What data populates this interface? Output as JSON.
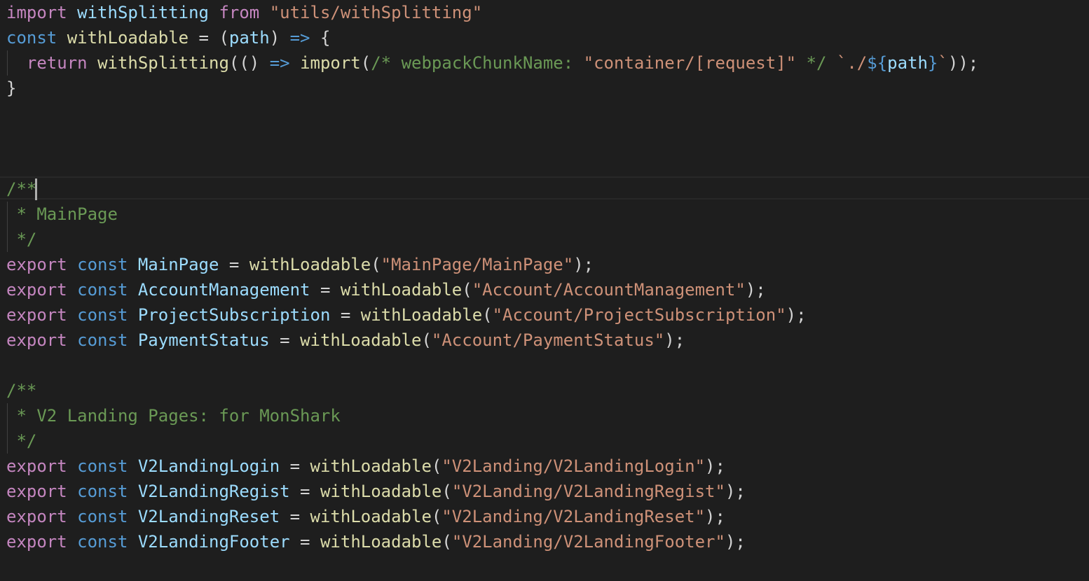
{
  "editor": {
    "lines": [
      {
        "tokens": [
          {
            "t": "import",
            "c": "kw"
          },
          {
            "t": " ",
            "c": "plain"
          },
          {
            "t": "withSplitting",
            "c": "var"
          },
          {
            "t": " ",
            "c": "plain"
          },
          {
            "t": "from",
            "c": "kw"
          },
          {
            "t": " ",
            "c": "plain"
          },
          {
            "t": "\"utils/withSplitting\"",
            "c": "str"
          }
        ]
      },
      {
        "tokens": [
          {
            "t": "const",
            "c": "storage"
          },
          {
            "t": " ",
            "c": "plain"
          },
          {
            "t": "withLoadable",
            "c": "fn"
          },
          {
            "t": " = (",
            "c": "plain"
          },
          {
            "t": "path",
            "c": "var"
          },
          {
            "t": ") ",
            "c": "plain"
          },
          {
            "t": "=>",
            "c": "storage"
          },
          {
            "t": " {",
            "c": "plain"
          }
        ]
      },
      {
        "tokens": [
          {
            "t": "  ",
            "c": "plain"
          },
          {
            "t": "return",
            "c": "kw"
          },
          {
            "t": " ",
            "c": "plain"
          },
          {
            "t": "withSplitting",
            "c": "fn"
          },
          {
            "t": "(() ",
            "c": "plain"
          },
          {
            "t": "=>",
            "c": "storage"
          },
          {
            "t": " ",
            "c": "plain"
          },
          {
            "t": "import",
            "c": "fn"
          },
          {
            "t": "(",
            "c": "plain"
          },
          {
            "t": "/* webpackChunkName: ",
            "c": "cmt"
          },
          {
            "t": "\"container/[request]\"",
            "c": "str"
          },
          {
            "t": " */",
            "c": "cmt"
          },
          {
            "t": " ",
            "c": "plain"
          },
          {
            "t": "`./",
            "c": "str"
          },
          {
            "t": "${",
            "c": "storage"
          },
          {
            "t": "path",
            "c": "var"
          },
          {
            "t": "}",
            "c": "storage"
          },
          {
            "t": "`",
            "c": "str"
          },
          {
            "t": "));",
            "c": "plain"
          }
        ]
      },
      {
        "tokens": [
          {
            "t": "}",
            "c": "plain"
          }
        ]
      },
      {
        "tokens": []
      },
      {
        "tokens": []
      },
      {
        "tokens": []
      },
      {
        "tokens": [
          {
            "t": "/**",
            "c": "cmt"
          }
        ]
      },
      {
        "tokens": [
          {
            "t": " * MainPage",
            "c": "cmt"
          }
        ]
      },
      {
        "tokens": [
          {
            "t": " */",
            "c": "cmt"
          }
        ]
      },
      {
        "tokens": [
          {
            "t": "export",
            "c": "kw"
          },
          {
            "t": " ",
            "c": "plain"
          },
          {
            "t": "const",
            "c": "storage"
          },
          {
            "t": " ",
            "c": "plain"
          },
          {
            "t": "MainPage",
            "c": "var"
          },
          {
            "t": " = ",
            "c": "plain"
          },
          {
            "t": "withLoadable",
            "c": "fn"
          },
          {
            "t": "(",
            "c": "plain"
          },
          {
            "t": "\"MainPage/MainPage\"",
            "c": "str"
          },
          {
            "t": ");",
            "c": "plain"
          }
        ]
      },
      {
        "tokens": [
          {
            "t": "export",
            "c": "kw"
          },
          {
            "t": " ",
            "c": "plain"
          },
          {
            "t": "const",
            "c": "storage"
          },
          {
            "t": " ",
            "c": "plain"
          },
          {
            "t": "AccountManagement",
            "c": "var"
          },
          {
            "t": " = ",
            "c": "plain"
          },
          {
            "t": "withLoadable",
            "c": "fn"
          },
          {
            "t": "(",
            "c": "plain"
          },
          {
            "t": "\"Account/AccountManagement\"",
            "c": "str"
          },
          {
            "t": ");",
            "c": "plain"
          }
        ]
      },
      {
        "tokens": [
          {
            "t": "export",
            "c": "kw"
          },
          {
            "t": " ",
            "c": "plain"
          },
          {
            "t": "const",
            "c": "storage"
          },
          {
            "t": " ",
            "c": "plain"
          },
          {
            "t": "ProjectSubscription",
            "c": "var"
          },
          {
            "t": " = ",
            "c": "plain"
          },
          {
            "t": "withLoadable",
            "c": "fn"
          },
          {
            "t": "(",
            "c": "plain"
          },
          {
            "t": "\"Account/ProjectSubscription\"",
            "c": "str"
          },
          {
            "t": ");",
            "c": "plain"
          }
        ]
      },
      {
        "tokens": [
          {
            "t": "export",
            "c": "kw"
          },
          {
            "t": " ",
            "c": "plain"
          },
          {
            "t": "const",
            "c": "storage"
          },
          {
            "t": " ",
            "c": "plain"
          },
          {
            "t": "PaymentStatus",
            "c": "var"
          },
          {
            "t": " = ",
            "c": "plain"
          },
          {
            "t": "withLoadable",
            "c": "fn"
          },
          {
            "t": "(",
            "c": "plain"
          },
          {
            "t": "\"Account/PaymentStatus\"",
            "c": "str"
          },
          {
            "t": ");",
            "c": "plain"
          }
        ]
      },
      {
        "tokens": []
      },
      {
        "tokens": [
          {
            "t": "/**",
            "c": "cmt"
          }
        ]
      },
      {
        "tokens": [
          {
            "t": " * V2 Landing Pages: for MonShark",
            "c": "cmt"
          }
        ]
      },
      {
        "tokens": [
          {
            "t": " */",
            "c": "cmt"
          }
        ]
      },
      {
        "tokens": [
          {
            "t": "export",
            "c": "kw"
          },
          {
            "t": " ",
            "c": "plain"
          },
          {
            "t": "const",
            "c": "storage"
          },
          {
            "t": " ",
            "c": "plain"
          },
          {
            "t": "V2LandingLogin",
            "c": "var"
          },
          {
            "t": " = ",
            "c": "plain"
          },
          {
            "t": "withLoadable",
            "c": "fn"
          },
          {
            "t": "(",
            "c": "plain"
          },
          {
            "t": "\"V2Landing/V2LandingLogin\"",
            "c": "str"
          },
          {
            "t": ");",
            "c": "plain"
          }
        ]
      },
      {
        "tokens": [
          {
            "t": "export",
            "c": "kw"
          },
          {
            "t": " ",
            "c": "plain"
          },
          {
            "t": "const",
            "c": "storage"
          },
          {
            "t": " ",
            "c": "plain"
          },
          {
            "t": "V2LandingRegist",
            "c": "var"
          },
          {
            "t": " = ",
            "c": "plain"
          },
          {
            "t": "withLoadable",
            "c": "fn"
          },
          {
            "t": "(",
            "c": "plain"
          },
          {
            "t": "\"V2Landing/V2LandingRegist\"",
            "c": "str"
          },
          {
            "t": ");",
            "c": "plain"
          }
        ]
      },
      {
        "tokens": [
          {
            "t": "export",
            "c": "kw"
          },
          {
            "t": " ",
            "c": "plain"
          },
          {
            "t": "const",
            "c": "storage"
          },
          {
            "t": " ",
            "c": "plain"
          },
          {
            "t": "V2LandingReset",
            "c": "var"
          },
          {
            "t": " = ",
            "c": "plain"
          },
          {
            "t": "withLoadable",
            "c": "fn"
          },
          {
            "t": "(",
            "c": "plain"
          },
          {
            "t": "\"V2Landing/V2LandingReset\"",
            "c": "str"
          },
          {
            "t": ");",
            "c": "plain"
          }
        ]
      },
      {
        "tokens": [
          {
            "t": "export",
            "c": "kw"
          },
          {
            "t": " ",
            "c": "plain"
          },
          {
            "t": "const",
            "c": "storage"
          },
          {
            "t": " ",
            "c": "plain"
          },
          {
            "t": "V2LandingFooter",
            "c": "var"
          },
          {
            "t": " = ",
            "c": "plain"
          },
          {
            "t": "withLoadable",
            "c": "fn"
          },
          {
            "t": "(",
            "c": "plain"
          },
          {
            "t": "\"V2Landing/V2LandingFooter\"",
            "c": "str"
          },
          {
            "t": ");",
            "c": "plain"
          }
        ]
      }
    ]
  },
  "theme": {
    "background": "#1e1e1e",
    "keyword": "#c586c0",
    "storage": "#569cd6",
    "variable": "#9cdcfe",
    "function": "#dcdcaa",
    "string": "#ce9178",
    "comment": "#6a9955",
    "plain": "#d4d4d4"
  }
}
